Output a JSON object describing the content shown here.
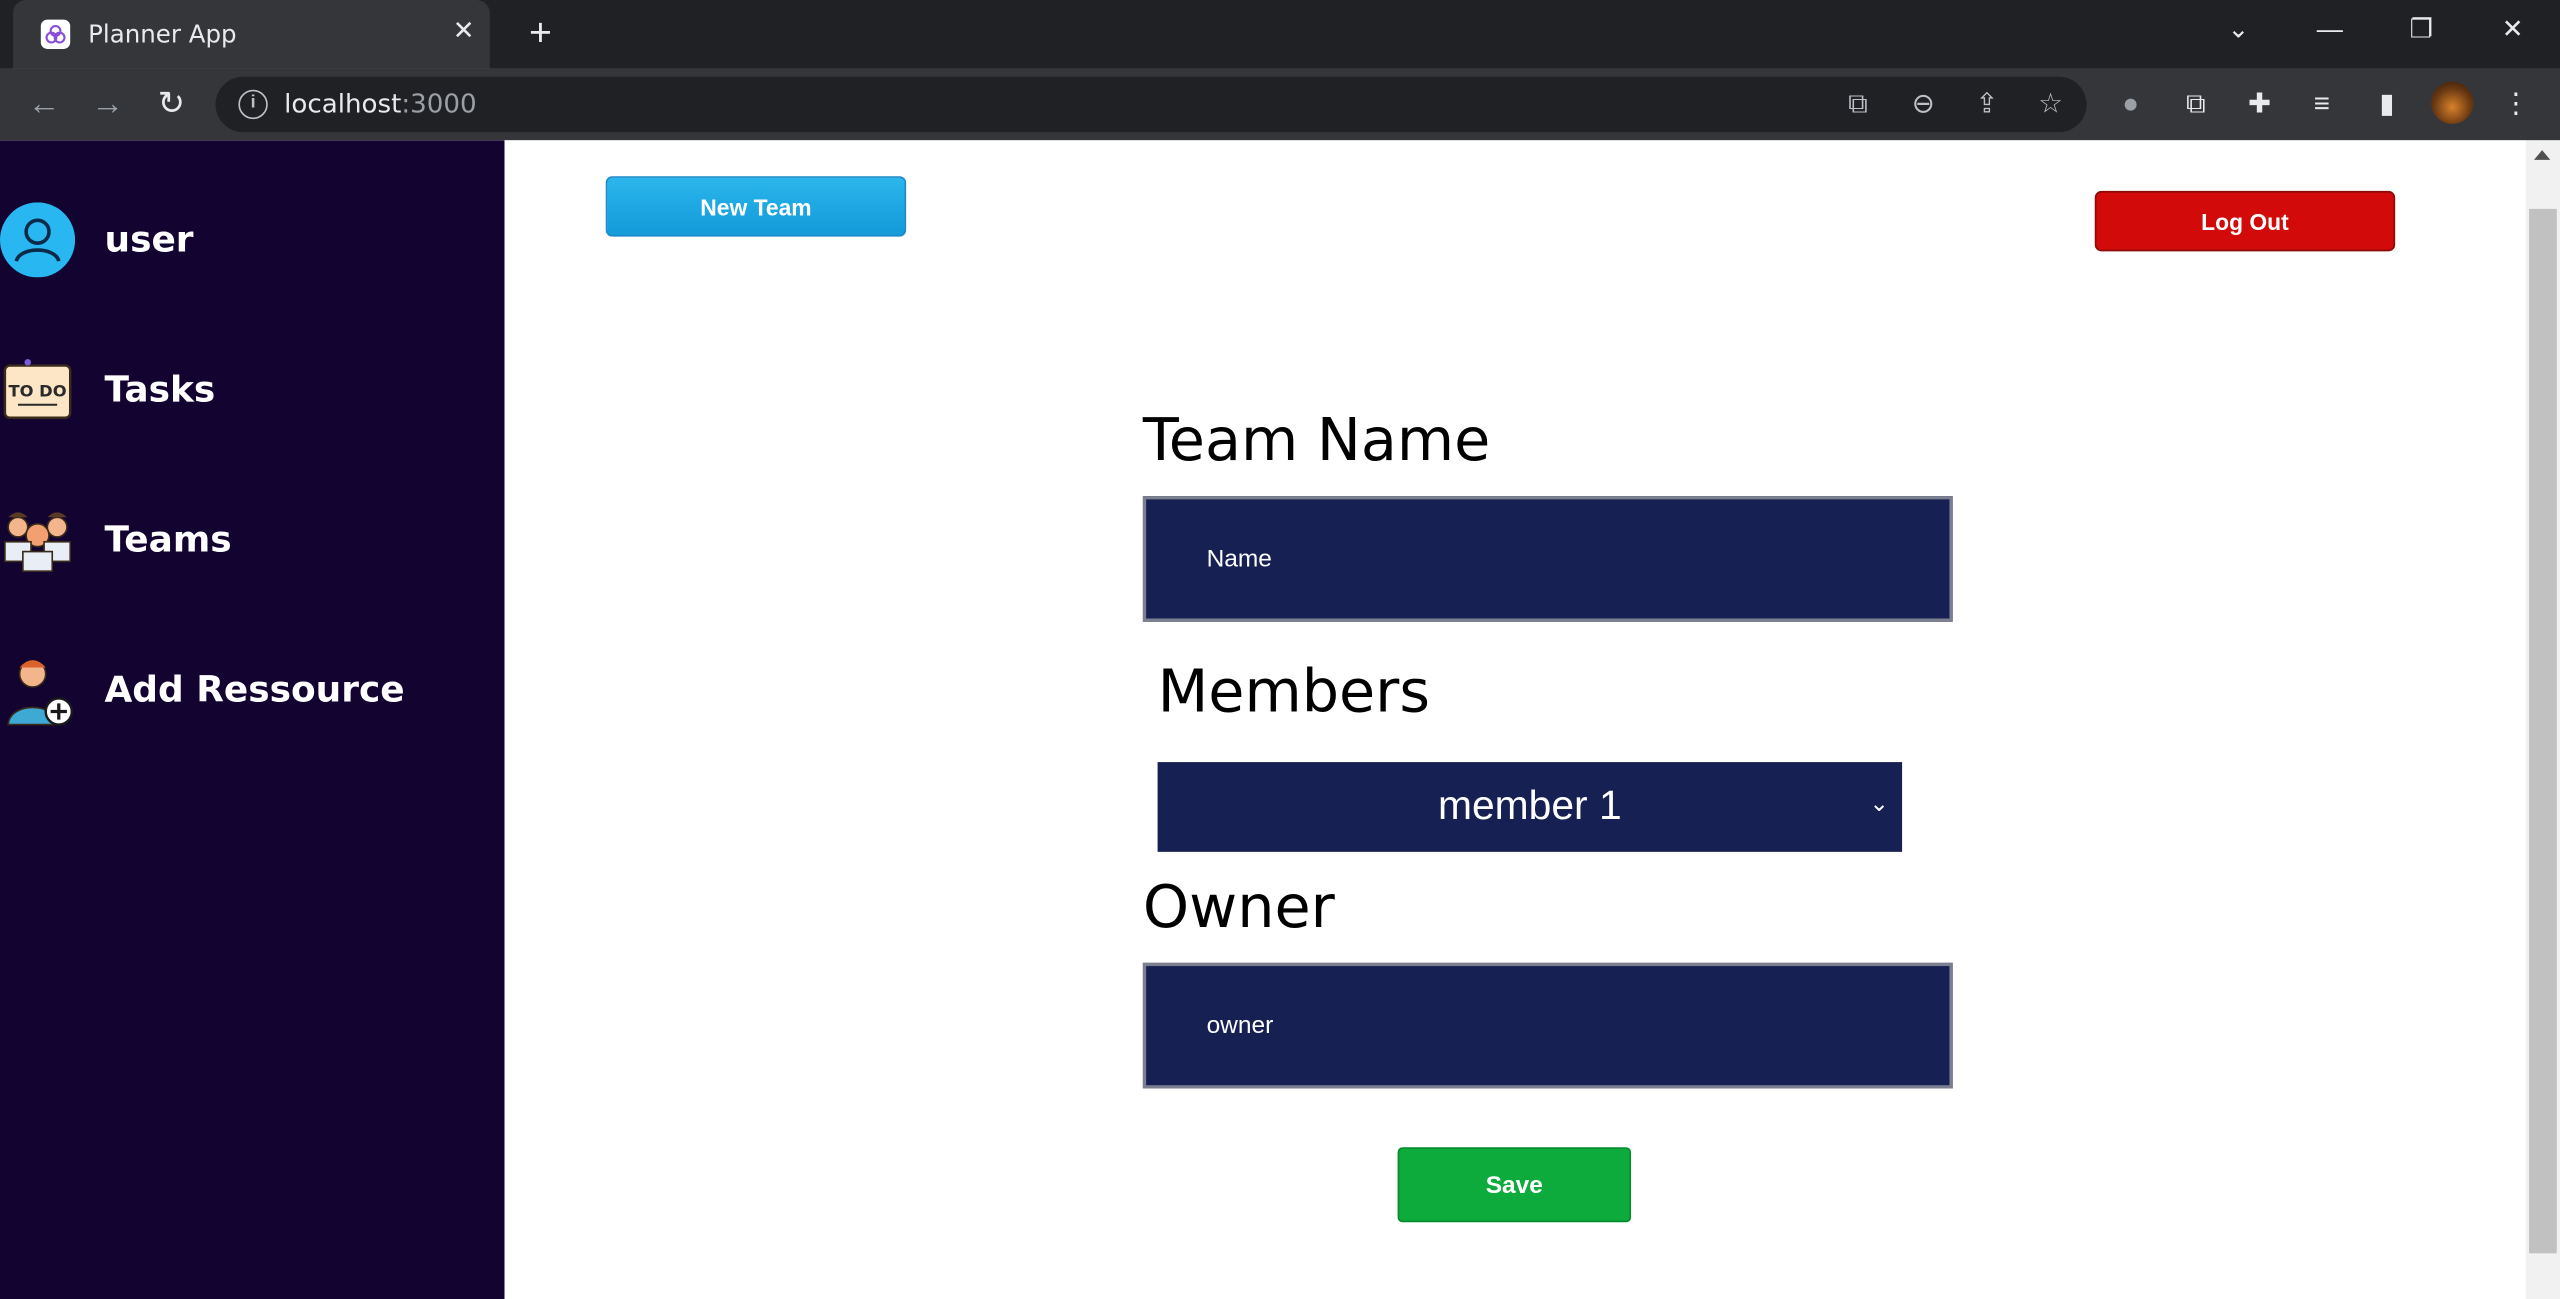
{
  "browser": {
    "tab_title": "Planner App",
    "url_host": "localhost",
    "url_port": ":3000",
    "icons": {
      "favicon": "planner-app-icon",
      "close": "close-icon",
      "new_tab": "plus-icon",
      "back": "arrow-left-icon",
      "forward": "arrow-right-icon",
      "reload": "reload-icon",
      "info": "info-icon",
      "translate": "translate-icon",
      "zoom": "zoom-out-icon",
      "share": "share-icon",
      "bookmark": "star-icon",
      "extensions": "puzzle-icon",
      "menu": "kebab-menu-icon"
    }
  },
  "sidebar": {
    "items": [
      {
        "label": "user",
        "icon": "user-avatar-icon"
      },
      {
        "label": "Tasks",
        "icon": "todo-note-icon"
      },
      {
        "label": "Teams",
        "icon": "team-people-icon"
      },
      {
        "label": "Add Ressource",
        "icon": "add-person-icon"
      }
    ]
  },
  "header": {
    "new_team_label": "New Team",
    "logout_label": "Log Out"
  },
  "form": {
    "team_name_label": "Team Name",
    "team_name_placeholder": "Name",
    "members_label": "Members",
    "members_selected": "member 1",
    "owner_label": "Owner",
    "owner_placeholder": "owner",
    "save_label": "Save"
  },
  "colors": {
    "sidebar_bg": "#130331",
    "field_bg": "#162052",
    "new_team": "#1fa8e3",
    "logout": "#d20a0a",
    "save": "#0cab3c"
  }
}
